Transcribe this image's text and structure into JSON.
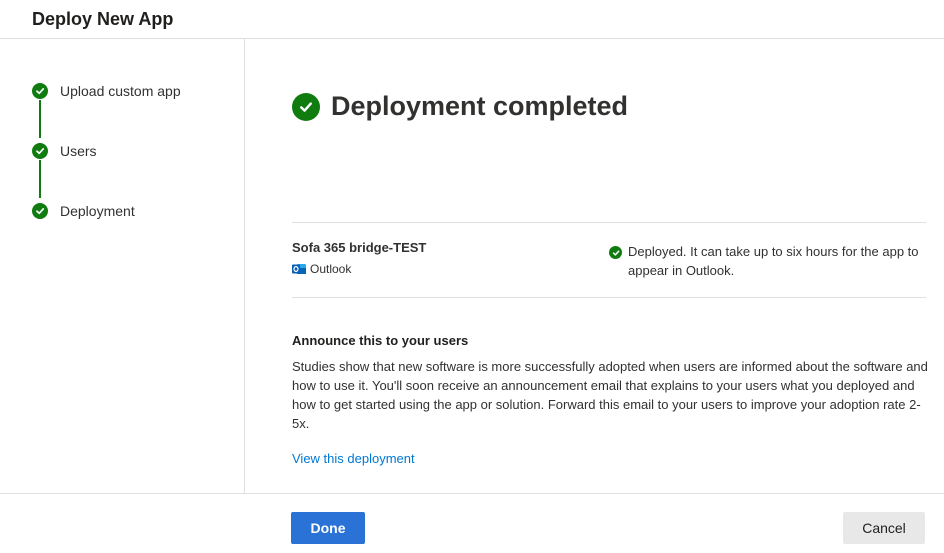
{
  "header": {
    "title": "Deploy New App"
  },
  "steps": [
    {
      "label": "Upload custom app",
      "status": "complete"
    },
    {
      "label": "Users",
      "status": "complete"
    },
    {
      "label": "Deployment",
      "status": "complete"
    }
  ],
  "main": {
    "title": "Deployment completed",
    "app": {
      "name": "Sofa 365 bridge-TEST",
      "host": "Outlook",
      "host_icon": "outlook-icon",
      "status_text": "Deployed. It can take up to six hours for the app to appear in Outlook."
    },
    "announce": {
      "title": "Announce this to your users",
      "body": "Studies show that new software is more successfully adopted when users are informed about the software and how to use it. You'll soon receive an announcement email that explains to your users what you deployed and how to get started using the app or solution. Forward this email to your users to improve your adoption rate 2-5x."
    },
    "link": "View this deployment"
  },
  "footer": {
    "done_label": "Done",
    "cancel_label": "Cancel"
  },
  "colors": {
    "success": "#107c10",
    "primary": "#2b72d6",
    "link": "#0078d4",
    "border": "#e1dfdd"
  }
}
